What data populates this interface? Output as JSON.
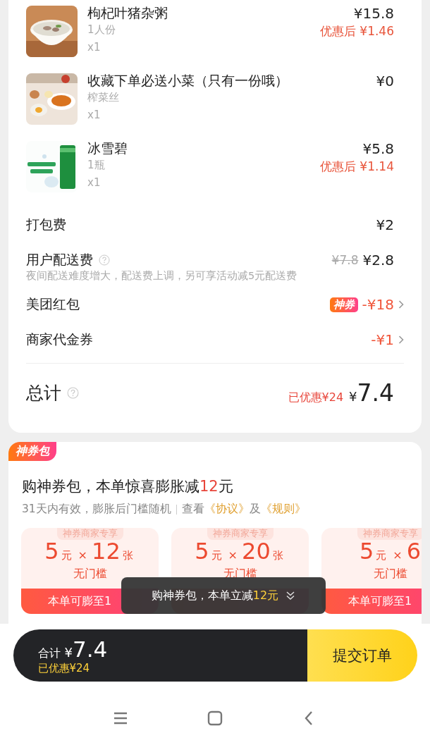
{
  "items": [
    {
      "name": "枸杞叶猪杂粥",
      "spec": "1人份",
      "qty": "x1",
      "price": "¥15.8",
      "discount_price": "优惠后 ¥1.46"
    },
    {
      "name": "收藏下单必送小菜（只有一份哦）",
      "spec": "榨菜丝",
      "qty": "x1",
      "price": "¥0"
    },
    {
      "name": "冰雪碧",
      "spec": "1瓶",
      "qty": "x1",
      "price": "¥5.8",
      "discount_price": "优惠后 ¥1.14"
    }
  ],
  "fees": [
    {
      "kind": "plain",
      "label": "打包费",
      "value": "¥2"
    },
    {
      "kind": "delivery",
      "label": "用户配送费",
      "help": true,
      "original": "¥7.8",
      "value": "¥2.8",
      "note": "夜间配送难度增大，配送费上调，另可享活动减5元配送费"
    },
    {
      "kind": "coupon",
      "label": "美团红包",
      "badge": "神券",
      "value": "-¥18"
    },
    {
      "kind": "coupon",
      "label": "商家代金券",
      "value": "-¥1"
    }
  ],
  "total": {
    "label": "总计",
    "help": true,
    "saved": "已优惠¥24",
    "currency": "¥",
    "amount": "7.4"
  },
  "coupon_pack": {
    "tag": "神券包",
    "title_prefix": "购神券包，本单惊喜膨胀减",
    "title_highlight": "12",
    "title_suffix": "元",
    "subtitle": "31天内有效，膨胀后门槛随机",
    "view_label": "查看",
    "links": [
      "《协议》",
      "《规则》"
    ],
    "joiner": "及",
    "cards": [
      {
        "header": "神券商家专享",
        "amount": "5",
        "unit": "元",
        "times": "×",
        "count": "12",
        "count_unit": "张",
        "threshold": "无门槛",
        "footer": "本单可膨至1"
      },
      {
        "header": "神券商家专享",
        "amount": "5",
        "unit": "元",
        "times": "×",
        "count": "20",
        "count_unit": "张",
        "threshold": "无门槛"
      },
      {
        "header": "神券商家专享",
        "amount": "5",
        "unit": "元",
        "times": "×",
        "count": "6",
        "threshold": "无门槛",
        "footer": "本单可膨至1"
      }
    ],
    "toast": {
      "text": "购神券包，本单立减",
      "highlight": "12元"
    }
  },
  "bottom_bar": {
    "label": "合计",
    "currency": "¥",
    "amount": "7.4",
    "saved": "已优惠¥24",
    "submit": "提交订单"
  }
}
